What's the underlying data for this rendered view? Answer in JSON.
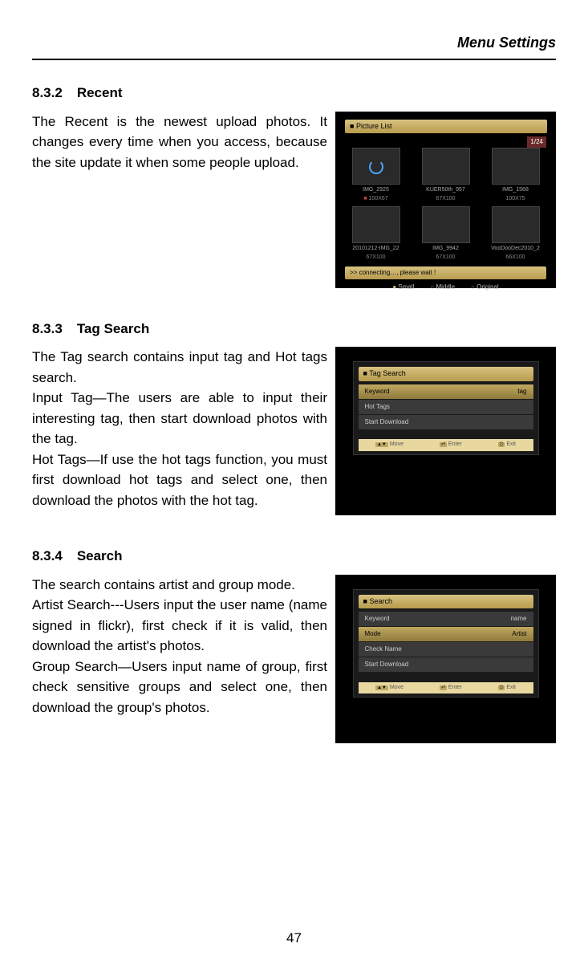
{
  "header": {
    "title": "Menu Settings"
  },
  "sections": {
    "recent": {
      "num": "8.3.2",
      "title": "Recent",
      "para": "The Recent is the newest upload photos. It changes every time when you access, because the site update it when some people upload."
    },
    "tagsearch": {
      "num": "8.3.3",
      "title": "Tag Search",
      "para1": "The Tag search contains input tag and Hot tags search.",
      "para2": "Input Tag—The users are able to input their interesting tag, then start download photos with the tag.",
      "para3": "Hot Tags—If use the hot tags function, you must first download hot tags and select one, then download the photos with the hot tag."
    },
    "search": {
      "num": "8.3.4",
      "title": "Search",
      "para1": "The search contains artist and group mode.",
      "para2": "Artist Search---Users input the user name (name signed in flickr), first check if it is valid, then download the artist's photos.",
      "para3": "Group Search—Users input name of group, first check sensitive groups and select one, then download the group's photos."
    }
  },
  "figures": {
    "piclist": {
      "title": "Picture List",
      "counter": "1/24",
      "status": ">> connecting…, please wait !",
      "sizes": {
        "small": "Small",
        "middle": "Middle",
        "original": "Original"
      },
      "thumbs": [
        {
          "name": "IMG_2925",
          "dim": "100X67"
        },
        {
          "name": "KUER50th_957",
          "dim": "67X100"
        },
        {
          "name": "IMG_1568",
          "dim": "100X75"
        },
        {
          "name": "20101212-IMG_22",
          "dim": "67X100"
        },
        {
          "name": "IMG_9942",
          "dim": "67X100"
        },
        {
          "name": "VooDooDec2010_2",
          "dim": "66X100"
        }
      ]
    },
    "tagsearch": {
      "title": "Tag Search",
      "rows": {
        "keyword_label": "Keyword",
        "keyword_value": "tag",
        "hot": "Hot Tags",
        "start": "Start Download"
      },
      "hints": {
        "move": "Move",
        "enter": "Enter",
        "exit": "Exit"
      }
    },
    "search": {
      "title": "Search",
      "rows": {
        "keyword_label": "Keyword",
        "keyword_value": "name",
        "mode_label": "Mode",
        "mode_value": "Artist",
        "check": "Check Name",
        "start": "Start Download"
      },
      "hints": {
        "move": "Move",
        "enter": "Enter",
        "exit": "Exit"
      }
    }
  },
  "page_number": "47"
}
